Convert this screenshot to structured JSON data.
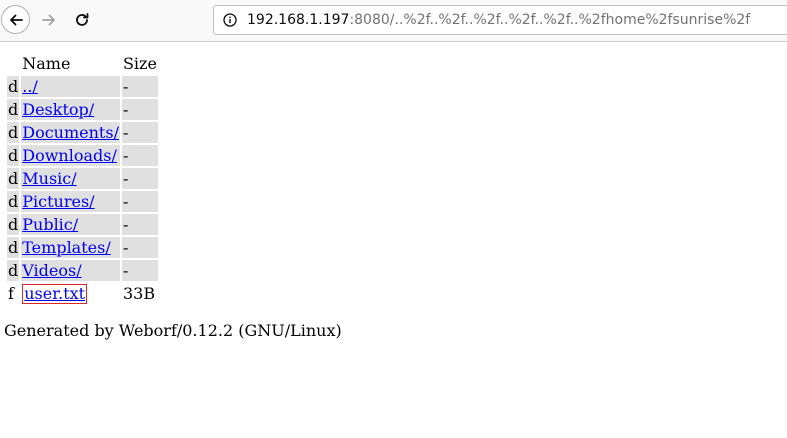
{
  "browser": {
    "url_host": "192.168.1.197",
    "url_rest": ":8080/..%2f..%2f..%2f..%2f..%2f..%2fhome%2fsunrise%2f"
  },
  "listing": {
    "headers": {
      "name": "Name",
      "size": "Size"
    },
    "rows": [
      {
        "type": "d",
        "name": "../",
        "size": "-"
      },
      {
        "type": "d",
        "name": "Desktop/",
        "size": "-"
      },
      {
        "type": "d",
        "name": "Documents/",
        "size": "-"
      },
      {
        "type": "d",
        "name": "Downloads/",
        "size": "-"
      },
      {
        "type": "d",
        "name": "Music/",
        "size": "-"
      },
      {
        "type": "d",
        "name": "Pictures/",
        "size": "-"
      },
      {
        "type": "d",
        "name": "Public/",
        "size": "-"
      },
      {
        "type": "d",
        "name": "Templates/",
        "size": "-"
      },
      {
        "type": "d",
        "name": "Videos/",
        "size": "-"
      },
      {
        "type": "f",
        "name": "user.txt",
        "size": "33B"
      }
    ]
  },
  "footer": "Generated by Weborf/0.12.2 (GNU/Linux)"
}
